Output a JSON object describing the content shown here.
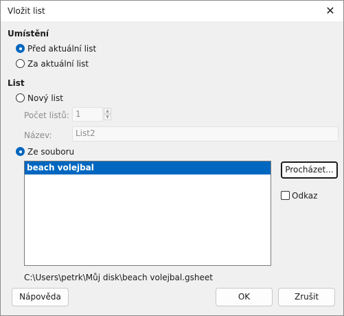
{
  "window": {
    "title": "Vložit list",
    "close_glyph": "✕"
  },
  "placement": {
    "label": "Umístění",
    "before": "Před aktuální list",
    "after": "Za aktuální list"
  },
  "sheet": {
    "label": "List",
    "new_sheet": "Nový list",
    "count_label": "Počet listů:",
    "count_value": "1",
    "name_label": "Název:",
    "name_value": "List2",
    "from_file": "Ze souboru",
    "list_items": [
      "beach volejbal"
    ],
    "browse_button": "Procházet...",
    "link_label": "Odkaz",
    "file_path": "C:\\Users\\petrk\\Můj disk\\beach volejbal.gsheet"
  },
  "footer": {
    "help_button": "Nápověda",
    "ok_button": "OK",
    "cancel_button": "Zrušit"
  }
}
